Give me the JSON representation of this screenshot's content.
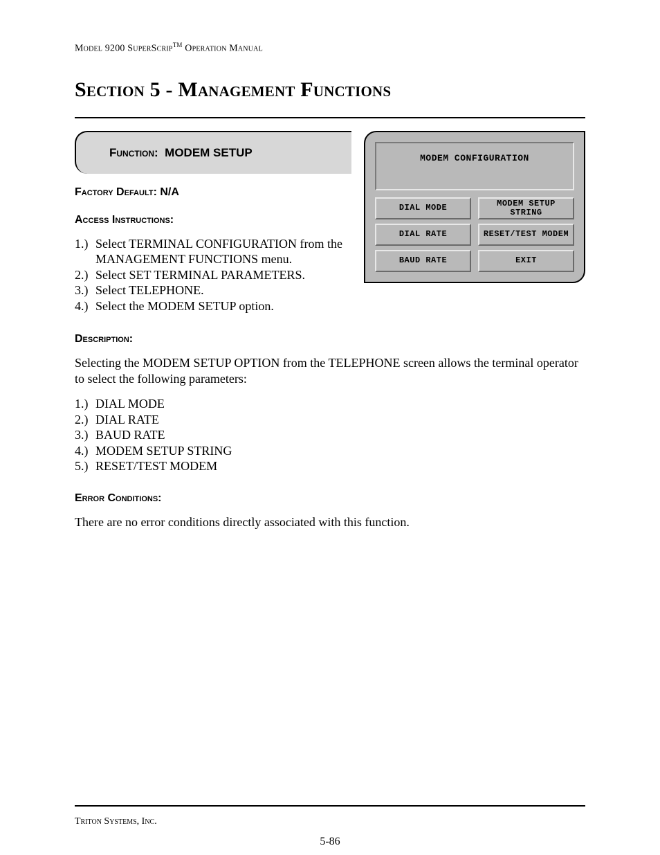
{
  "header": {
    "model": "Model 9200 SuperScrip",
    "tm": "TM",
    "manual": " Operation Manual"
  },
  "section_title": "Section 5 - Management Functions",
  "function_banner": {
    "label": "Function:",
    "name": "MODEM SETUP"
  },
  "factory_default": {
    "label": "Factory Default:",
    "value": "N/A"
  },
  "access": {
    "label": "Access Instructions:",
    "steps": [
      {
        "num": "1.)",
        "text": "Select TERMINAL CONFIGURATION from the MANAGEMENT FUNCTIONS menu."
      },
      {
        "num": "2.)",
        "text": "Select SET TERMINAL PARAMETERS."
      },
      {
        "num": "3.)",
        "text": "Select TELEPHONE."
      },
      {
        "num": "4.)",
        "text": "Select the MODEM SETUP option."
      }
    ]
  },
  "description": {
    "label": "Description:",
    "text": "Selecting the MODEM SETUP OPTION from the TELEPHONE screen allows the terminal operator to select the following parameters:",
    "params": [
      {
        "num": "1.)",
        "text": "DIAL MODE"
      },
      {
        "num": "2.)",
        "text": "DIAL RATE"
      },
      {
        "num": "3.)",
        "text": "BAUD RATE"
      },
      {
        "num": "4.)",
        "text": "MODEM SETUP STRING"
      },
      {
        "num": "5.)",
        "text": "RESET/TEST MODEM"
      }
    ]
  },
  "error": {
    "label": "Error Conditions:",
    "text": "There are no error conditions directly associated with this function."
  },
  "panel": {
    "title": "MODEM CONFIGURATION",
    "buttons": [
      "DIAL MODE",
      "MODEM SETUP STRING",
      "DIAL RATE",
      "RESET/TEST MODEM",
      "BAUD RATE",
      "EXIT"
    ]
  },
  "footer": {
    "company": "Triton Systems, Inc.",
    "page": "5-86"
  }
}
